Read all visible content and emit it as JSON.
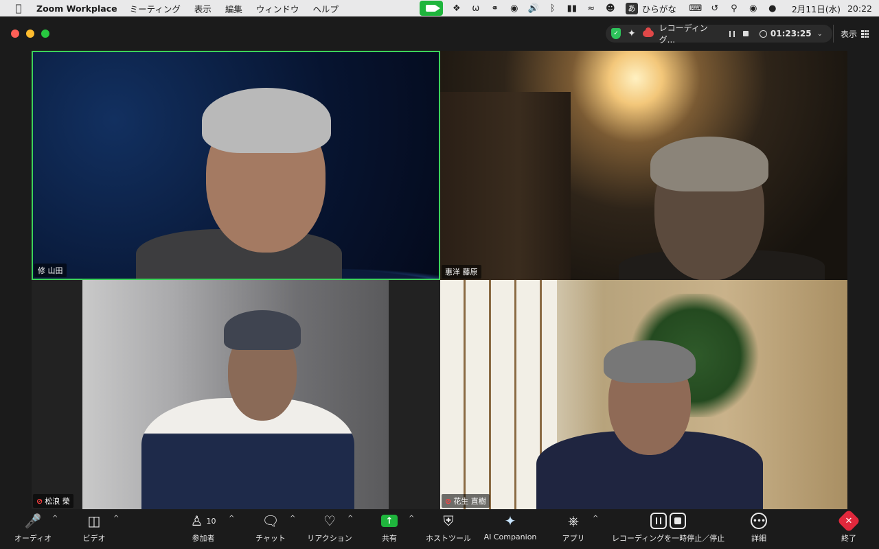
{
  "menubar": {
    "app_name": "Zoom Workplace",
    "items": [
      "ミーティング",
      "表示",
      "編集",
      "ウィンドウ",
      "ヘルプ"
    ],
    "ime_symbol": "あ",
    "ime_mode": "ひらがな",
    "date": "2月11日(水)",
    "time": "20:22"
  },
  "status": {
    "recording_label": "レコーディング...",
    "elapsed": "01:23:25",
    "view_label": "表示"
  },
  "participants": [
    {
      "name": "修 山田",
      "muted": false,
      "active_speaker": true
    },
    {
      "name": "惠洋 藤原",
      "muted": false,
      "active_speaker": false
    },
    {
      "name": "松浪 榮",
      "muted": true,
      "active_speaker": false
    },
    {
      "name": "花生 直樹",
      "muted": true,
      "active_speaker": false
    }
  ],
  "toolbar": {
    "audio": "オーディオ",
    "video": "ビデオ",
    "participants": "参加者",
    "participants_count": "10",
    "chat": "チャット",
    "reactions": "リアクション",
    "share": "共有",
    "host_tools": "ホストツール",
    "ai_companion": "AI Companion",
    "apps": "アプリ",
    "recording_control": "レコーディングを一時停止／停止",
    "more": "詳細",
    "end": "終了"
  },
  "colors": {
    "active_speaker_border": "#3cd35a",
    "share_green": "#1fb53d",
    "end_red": "#e0283c",
    "mute_red": "#ff4040"
  }
}
